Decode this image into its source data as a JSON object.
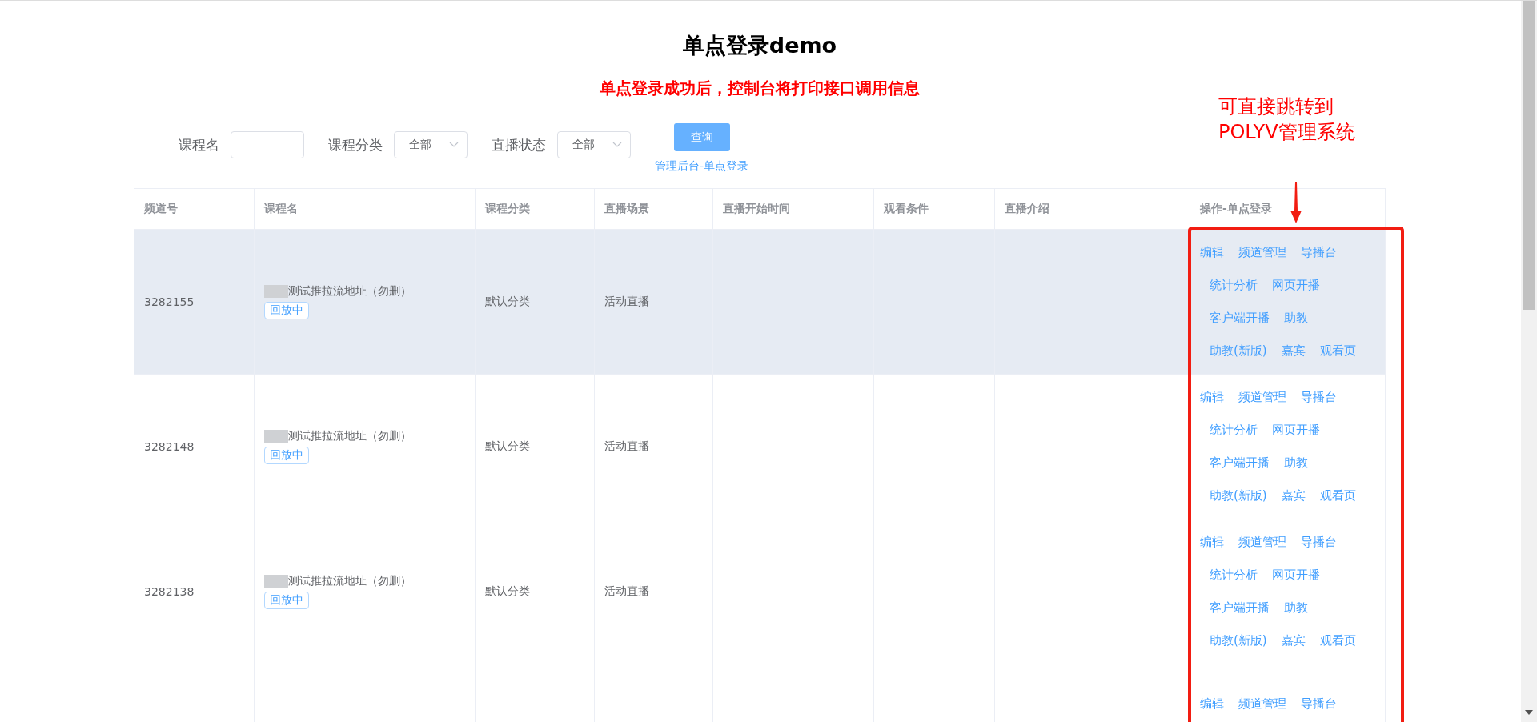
{
  "title": "单点登录demo",
  "notice": "单点登录成功后，控制台将打印接口调用信息",
  "filters": [
    {
      "kind": "input",
      "label": "课程名"
    },
    {
      "kind": "select",
      "label": "课程分类",
      "value": "全部"
    },
    {
      "kind": "select",
      "label": "直播状态",
      "value": "全部"
    }
  ],
  "search_button": "查询",
  "admin_link": "管理后台-单点登录",
  "table": {
    "columns": [
      "频道号",
      "课程名",
      "课程分类",
      "直播场景",
      "直播开始时间",
      "观看条件",
      "直播介绍",
      "操作-单点登录"
    ],
    "rows": [
      {
        "channel": "3282155",
        "name": "测试推拉流地址（勿删）",
        "tag": "回放中",
        "category": "默认分类",
        "scene": "活动直播",
        "highlighted": true,
        "actions": [
          [
            "编辑",
            "频道管理",
            "导播台"
          ],
          [
            "统计分析",
            "网页开播"
          ],
          [
            "客户端开播",
            "助教"
          ],
          [
            "助教(新版)",
            "嘉宾",
            "观看页"
          ]
        ]
      },
      {
        "channel": "3282148",
        "name": "测试推拉流地址（勿删）",
        "tag": "回放中",
        "category": "默认分类",
        "scene": "活动直播",
        "highlighted": false,
        "actions": [
          [
            "编辑",
            "频道管理",
            "导播台"
          ],
          [
            "统计分析",
            "网页开播"
          ],
          [
            "客户端开播",
            "助教"
          ],
          [
            "助教(新版)",
            "嘉宾",
            "观看页"
          ]
        ]
      },
      {
        "channel": "3282138",
        "name": "测试推拉流地址（勿删）",
        "tag": "回放中",
        "category": "默认分类",
        "scene": "活动直播",
        "highlighted": false,
        "actions": [
          [
            "编辑",
            "频道管理",
            "导播台"
          ],
          [
            "统计分析",
            "网页开播"
          ],
          [
            "客户端开播",
            "助教"
          ],
          [
            "助教(新版)",
            "嘉宾",
            "观看页"
          ]
        ]
      },
      {
        "highlighted": false,
        "actions": [
          [
            "编辑",
            "频道管理",
            "导播台"
          ]
        ]
      }
    ]
  },
  "annotation": {
    "lines": [
      "可直接跳转到",
      "POLYV管理系统"
    ]
  }
}
